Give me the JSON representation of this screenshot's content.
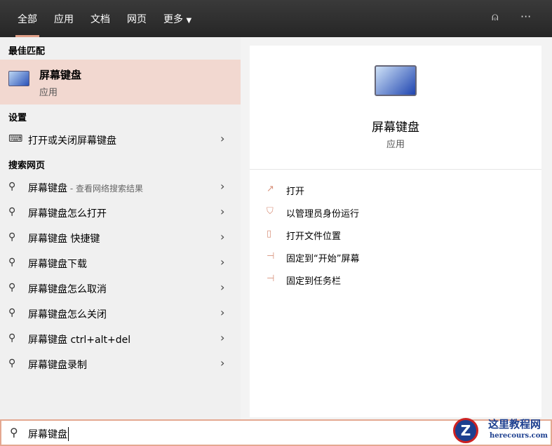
{
  "tabs": [
    "全部",
    "应用",
    "文档",
    "网页",
    "更多"
  ],
  "best_match": {
    "header": "最佳匹配",
    "title": "屏幕键盘",
    "subtitle": "应用"
  },
  "settings": {
    "header": "设置",
    "items": [
      {
        "label": "打开或关闭屏幕键盘"
      }
    ]
  },
  "web": {
    "header": "搜索网页",
    "items": [
      {
        "label": "屏幕键盘",
        "sub": " - 查看网络搜索结果"
      },
      {
        "label": "屏幕键盘怎么打开"
      },
      {
        "label": "屏幕键盘 快捷键"
      },
      {
        "label": "屏幕键盘下载"
      },
      {
        "label": "屏幕键盘怎么取消"
      },
      {
        "label": "屏幕键盘怎么关闭"
      },
      {
        "label": "屏幕键盘 ctrl+alt+del"
      },
      {
        "label": "屏幕键盘录制"
      }
    ]
  },
  "detail": {
    "title": "屏幕键盘",
    "subtitle": "应用",
    "actions": [
      "打开",
      "以管理员身份运行",
      "打开文件位置",
      "固定到“开始”屏幕",
      "固定到任务栏"
    ]
  },
  "search": {
    "value": "屏幕键盘"
  },
  "watermark": {
    "name": "这里教程网",
    "url": "herecours.com"
  },
  "accent": "#e0a088"
}
